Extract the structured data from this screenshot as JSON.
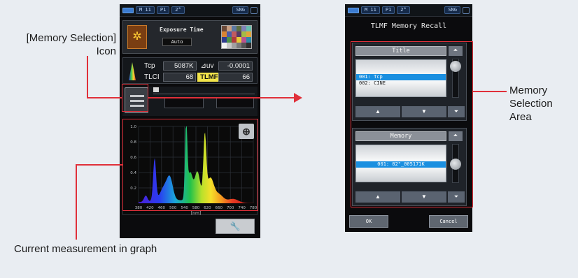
{
  "annotations": {
    "memory_icon_label": "[Memory Selection] Icon",
    "memory_area_label": "Memory Selection Area",
    "graph_label": "Current measurement in graph",
    "highlight_color": "#e0303a"
  },
  "left_screen": {
    "status": {
      "chips": [
        "M 11",
        "P1",
        "2°",
        "SNG"
      ]
    },
    "exposure": {
      "label": "Exposure Time",
      "value": "Auto",
      "icon": "sun-icon"
    },
    "measurements": {
      "tcp_label": "Tcp",
      "tcp_value": "5087K",
      "duv_label": "⊿uv",
      "duv_value": "-0.0001",
      "tlci_label": "TLCI",
      "tlci_value": "68",
      "tlmf_label": "TLMF",
      "tlmf_value": "66"
    },
    "graph": {
      "y_ticks": [
        "1.0",
        "0.8",
        "0.6",
        "0.4",
        "0.2"
      ],
      "x_ticks": [
        "380",
        "420",
        "460",
        "500",
        "540",
        "580",
        "620",
        "660",
        "700",
        "740",
        "780"
      ],
      "xlabel": "[nm]",
      "zoom_icon": "zoom-in-icon",
      "tool_icon": "wrench-icon"
    }
  },
  "right_screen": {
    "status": {
      "chips": [
        "M 11",
        "P1",
        "2°",
        "SNG"
      ]
    },
    "title": "TLMF Memory Recall",
    "title_group": {
      "header": "Title",
      "items": [
        "001: Tcp",
        "002: CINE"
      ],
      "selected_index": 0
    },
    "memory_group": {
      "header": "Memory",
      "items": [
        "001: 02\"_005171K"
      ],
      "selected_index": 0
    },
    "arrows": {
      "up": "▲",
      "down": "▼",
      "top": "⏶",
      "bottom": "⏷"
    },
    "ok_label": "OK",
    "cancel_label": "Cancel"
  }
}
